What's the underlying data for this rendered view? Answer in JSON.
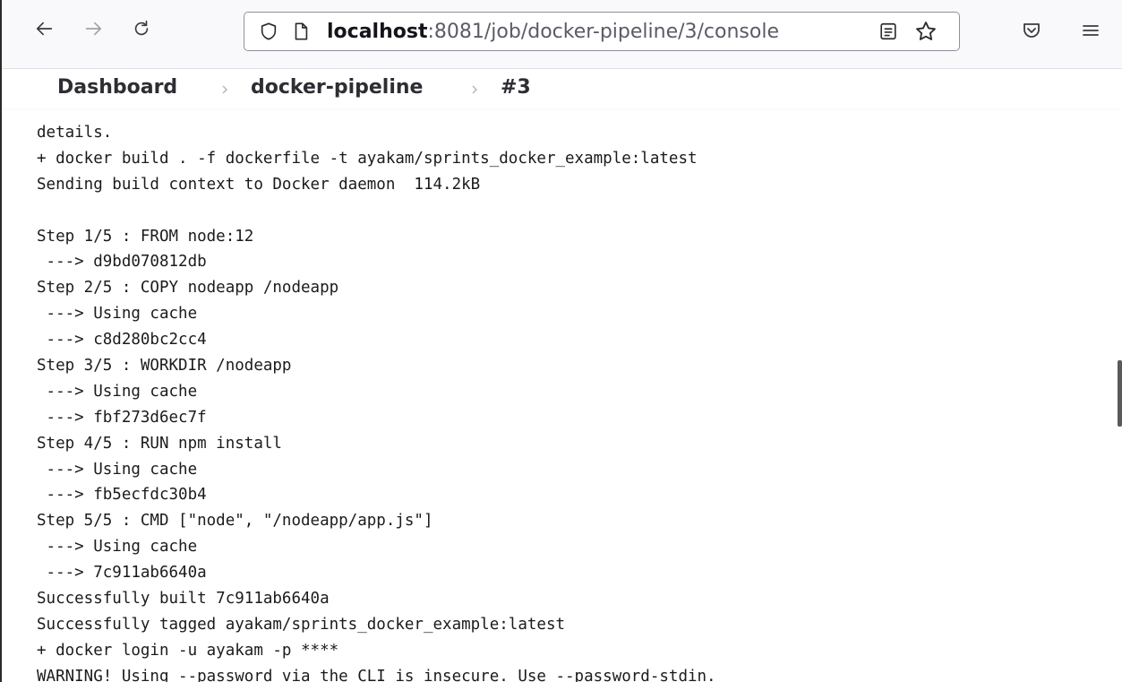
{
  "browser": {
    "url_host": "localhost",
    "url_path": ":8081/job/docker-pipeline/3/console",
    "icons": {
      "back": "arrow-left-icon",
      "forward": "arrow-right-icon",
      "reload": "reload-icon",
      "shield": "shield-icon",
      "page": "page-icon",
      "reader": "reader-view-icon",
      "star": "star-icon",
      "pocket": "pocket-icon",
      "menu": "hamburger-menu-icon"
    }
  },
  "breadcrumb": {
    "items": [
      "Dashboard",
      "docker-pipeline",
      "#3"
    ]
  },
  "console": {
    "lines": [
      "details.",
      "+ docker build . -f dockerfile -t ayakam/sprints_docker_example:latest",
      "Sending build context to Docker daemon  114.2kB",
      "",
      "Step 1/5 : FROM node:12",
      " ---> d9bd070812db",
      "Step 2/5 : COPY nodeapp /nodeapp",
      " ---> Using cache",
      " ---> c8d280bc2cc4",
      "Step 3/5 : WORKDIR /nodeapp",
      " ---> Using cache",
      " ---> fbf273d6ec7f",
      "Step 4/5 : RUN npm install",
      " ---> Using cache",
      " ---> fb5ecfdc30b4",
      "Step 5/5 : CMD [\"node\", \"/nodeapp/app.js\"]",
      " ---> Using cache",
      " ---> 7c911ab6640a",
      "Successfully built 7c911ab6640a",
      "Successfully tagged ayakam/sprints_docker_example:latest",
      "+ docker login -u ayakam -p ****",
      "WARNING! Using --password via the CLI is insecure. Use --password-stdin."
    ]
  },
  "colors": {
    "toolbar_bg": "#f9f9fb",
    "text": "#1b1b1b",
    "link_blue": "#1a6fc0"
  }
}
